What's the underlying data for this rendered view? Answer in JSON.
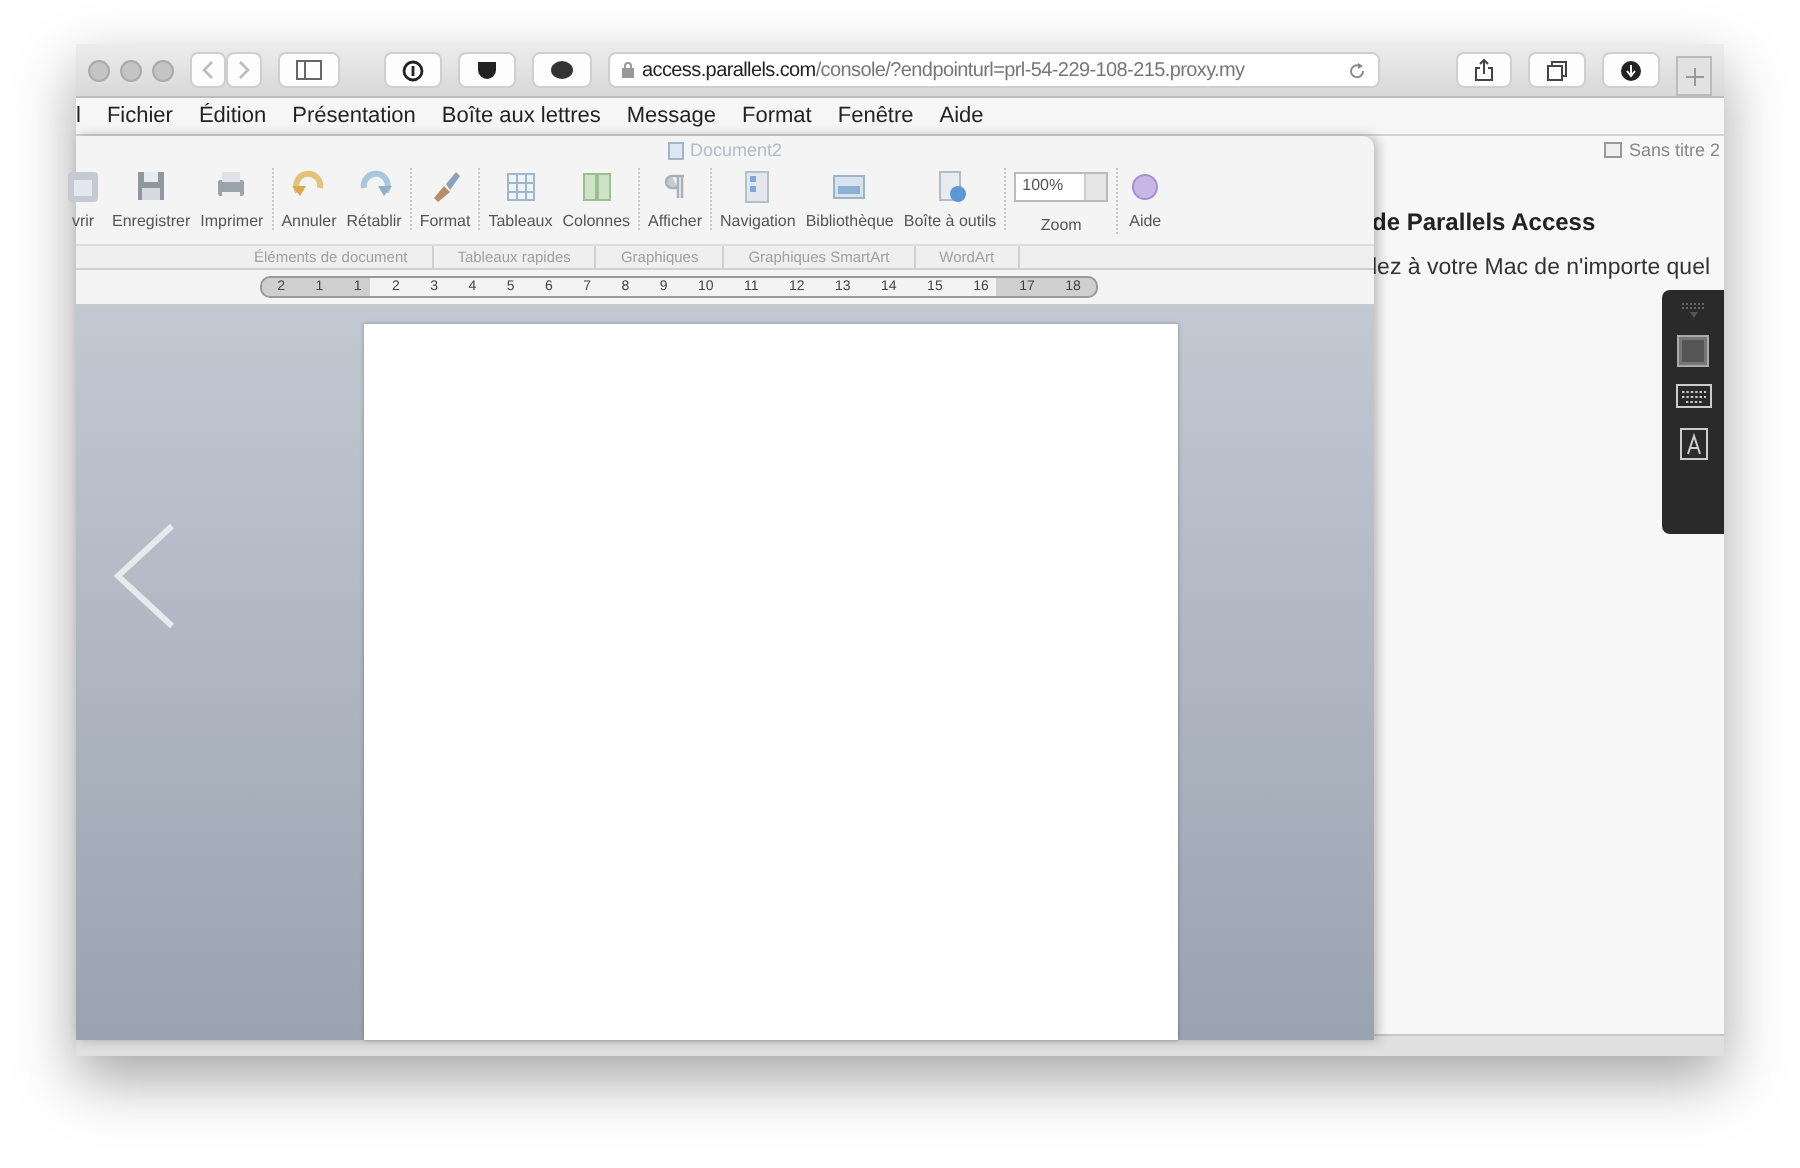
{
  "browser": {
    "url_host": "access.parallels.com",
    "url_path": "/console/?endpointurl=prl-54-229-108-215.proxy.my"
  },
  "menu": [
    "l",
    "Fichier",
    "Édition",
    "Présentation",
    "Boîte aux lettres",
    "Message",
    "Format",
    "Fenêtre",
    "Aide"
  ],
  "background_page": {
    "title": "Sans titre 2",
    "heading": "de Parallels Access",
    "text": "lez à votre Mac de n'importe quel"
  },
  "word": {
    "title": "Document2",
    "toolbar_sections": [
      {
        "buttons": [
          {
            "label": "vrir",
            "kind": "open"
          },
          {
            "label": "Enregistrer",
            "kind": "save"
          },
          {
            "label": "Imprimer",
            "kind": "print"
          }
        ]
      },
      {
        "buttons": [
          {
            "label": "Annuler",
            "kind": "undo"
          },
          {
            "label": "Rétablir",
            "kind": "redo"
          }
        ]
      },
      {
        "buttons": [
          {
            "label": "Format",
            "kind": "brush"
          }
        ]
      },
      {
        "buttons": [
          {
            "label": "Tableaux",
            "kind": "table"
          },
          {
            "label": "Colonnes",
            "kind": "columns"
          }
        ]
      },
      {
        "buttons": [
          {
            "label": "Afficher",
            "kind": "pilcrow"
          }
        ]
      },
      {
        "buttons": [
          {
            "label": "Navigation",
            "kind": "nav"
          },
          {
            "label": "Bibliothèque",
            "kind": "library"
          },
          {
            "label": "Boîte à outils",
            "kind": "toolbox"
          }
        ]
      },
      {
        "buttons": [
          {
            "label": "Zoom",
            "kind": "zoom",
            "value": "100%"
          }
        ]
      },
      {
        "buttons": [
          {
            "label": "Aide",
            "kind": "help"
          }
        ]
      }
    ],
    "groups": [
      "Éléments de document",
      "Tableaux rapides",
      "Graphiques",
      "Graphiques SmartArt",
      "WordArt"
    ],
    "ruler": [
      "2",
      "1",
      "1",
      "2",
      "3",
      "4",
      "5",
      "6",
      "7",
      "8",
      "9",
      "10",
      "11",
      "12",
      "13",
      "14",
      "15",
      "16",
      "17",
      "18"
    ]
  }
}
